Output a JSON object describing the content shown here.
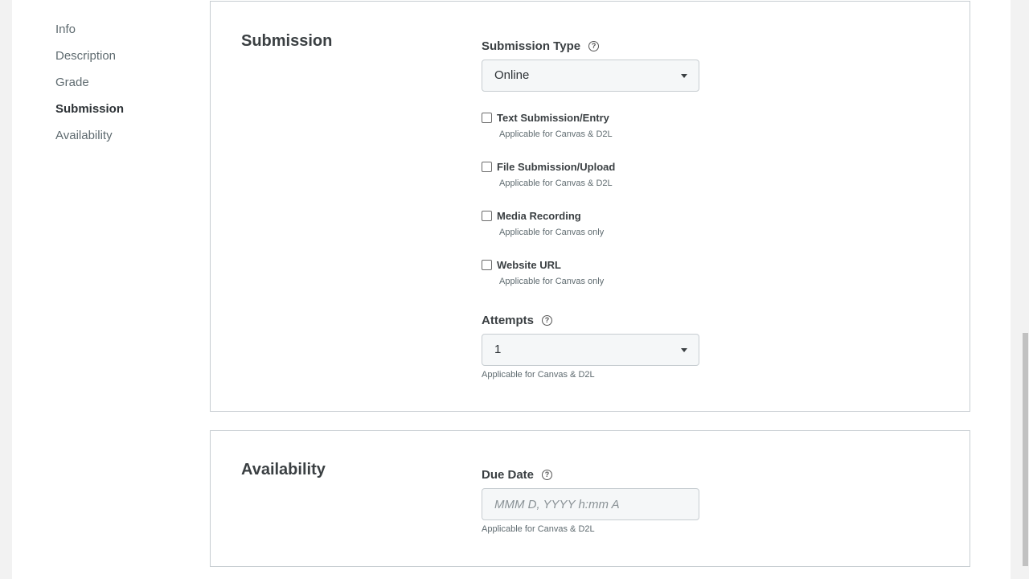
{
  "nav": {
    "items": [
      {
        "label": "Info"
      },
      {
        "label": "Description"
      },
      {
        "label": "Grade"
      },
      {
        "label": "Submission"
      },
      {
        "label": "Availability"
      }
    ],
    "active": "Submission"
  },
  "submission": {
    "title": "Submission",
    "type_label": "Submission Type",
    "type_value": "Online",
    "options": [
      {
        "label": "Text Submission/Entry",
        "note": "Applicable for Canvas & D2L"
      },
      {
        "label": "File Submission/Upload",
        "note": "Applicable for Canvas & D2L"
      },
      {
        "label": "Media Recording",
        "note": "Applicable for Canvas only"
      },
      {
        "label": "Website URL",
        "note": "Applicable for Canvas only"
      }
    ],
    "attempts_label": "Attempts",
    "attempts_value": "1",
    "attempts_note": "Applicable for Canvas & D2L"
  },
  "availability": {
    "title": "Availability",
    "due_label": "Due Date",
    "due_placeholder": "MMM D, YYYY h:mm A",
    "due_note": "Applicable for Canvas & D2L"
  },
  "icons": {
    "help": "?"
  }
}
